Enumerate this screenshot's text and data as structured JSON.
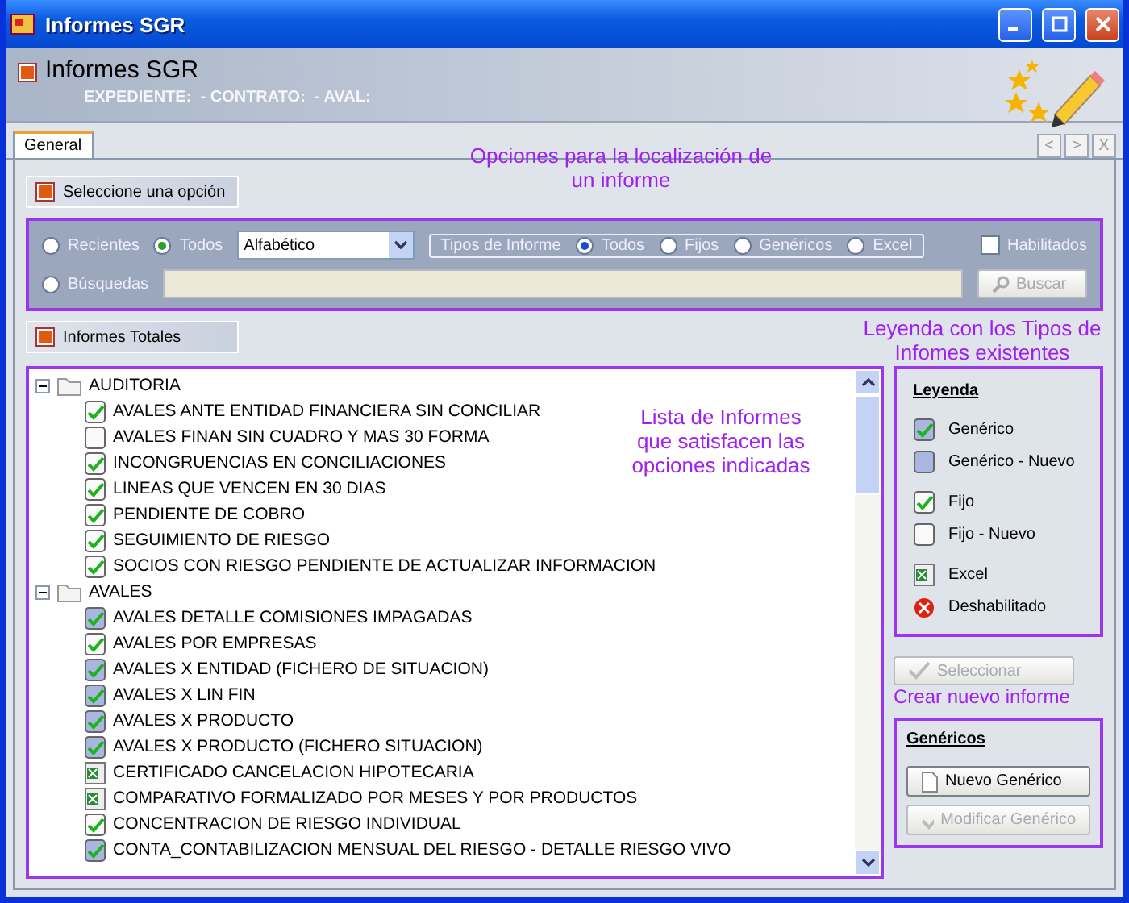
{
  "window": {
    "title": "Informes SGR"
  },
  "header": {
    "title": "Informes SGR",
    "subtitle": "EXPEDIENTE:  - CONTRATO:  - AVAL:"
  },
  "tabs": [
    {
      "label": "General",
      "selected": true
    }
  ],
  "tab_nav": [
    "<",
    ">",
    "X"
  ],
  "annotations": [
    {
      "lines": [
        "Opciones para la localización de",
        "un informe"
      ]
    },
    {
      "lines": [
        "Leyenda  con los Tipos de",
        "Infomes existentes"
      ]
    },
    {
      "lines": [
        "Lista de Informes",
        "que satisfacen las",
        "opciones indicadas"
      ]
    },
    {
      "lines": [
        "Crear nuevo informe"
      ]
    }
  ],
  "options_section": {
    "title": "Seleccione una opción"
  },
  "scope": [
    {
      "label": "Recientes",
      "selected": false
    },
    {
      "label": "Todos",
      "selected": true
    }
  ],
  "order_select": {
    "value": "Alfabético"
  },
  "report_types": {
    "legend": "Tipos de Informe",
    "options": [
      {
        "label": "Todos",
        "selected": true
      },
      {
        "label": "Fijos",
        "selected": false
      },
      {
        "label": "Genéricos",
        "selected": false
      },
      {
        "label": "Excel",
        "selected": false
      }
    ]
  },
  "enabled_filter": {
    "label": "Habilitados",
    "checked": false
  },
  "search": {
    "label": "Búsquedas",
    "selected": false,
    "button": "Buscar",
    "button_disabled": true
  },
  "list_section": {
    "title": "Informes Totales"
  },
  "tree": [
    {
      "label": "AUDITORIA",
      "expanded": true,
      "children": [
        {
          "label": "AVALES ANTE ENTIDAD FINANCIERA SIN CONCILIAR",
          "kind": "fijo"
        },
        {
          "label": "AVALES FINAN SIN CUADRO Y MAS 30 FORMA",
          "kind": "fijo_nuevo"
        },
        {
          "label": "INCONGRUENCIAS EN CONCILIACIONES",
          "kind": "fijo"
        },
        {
          "label": "LINEAS QUE VENCEN EN 30 DIAS",
          "kind": "fijo"
        },
        {
          "label": "PENDIENTE DE COBRO",
          "kind": "fijo"
        },
        {
          "label": "SEGUIMIENTO DE RIESGO",
          "kind": "fijo"
        },
        {
          "label": "SOCIOS CON RIESGO PENDIENTE DE ACTUALIZAR INFORMACION",
          "kind": "fijo"
        }
      ]
    },
    {
      "label": "AVALES",
      "expanded": true,
      "children": [
        {
          "label": "AVALES DETALLE COMISIONES IMPAGADAS",
          "kind": "generico"
        },
        {
          "label": "AVALES POR EMPRESAS",
          "kind": "fijo"
        },
        {
          "label": "AVALES X ENTIDAD (FICHERO DE SITUACION)",
          "kind": "generico"
        },
        {
          "label": "AVALES X LIN FIN",
          "kind": "generico"
        },
        {
          "label": "AVALES X PRODUCTO",
          "kind": "generico"
        },
        {
          "label": "AVALES X PRODUCTO (FICHERO SITUACION)",
          "kind": "generico"
        },
        {
          "label": "CERTIFICADO CANCELACION HIPOTECARIA",
          "kind": "excel"
        },
        {
          "label": "COMPARATIVO FORMALIZADO POR MESES Y POR PRODUCTOS",
          "kind": "excel"
        },
        {
          "label": "CONCENTRACION DE RIESGO INDIVIDUAL",
          "kind": "fijo"
        },
        {
          "label": "CONTA_CONTABILIZACION MENSUAL DEL RIESGO - DETALLE RIESGO VIVO",
          "kind": "generico"
        }
      ]
    }
  ],
  "legend": {
    "title": "Leyenda",
    "items": [
      {
        "label": "Genérico",
        "kind": "generico"
      },
      {
        "label": "Genérico - Nuevo",
        "kind": "generico_nuevo"
      },
      {
        "label": "Fijo",
        "kind": "fijo"
      },
      {
        "label": "Fijo - Nuevo",
        "kind": "fijo_nuevo"
      },
      {
        "label": "Excel",
        "kind": "excel"
      },
      {
        "label": "Deshabilitado",
        "kind": "deshabilitado"
      }
    ]
  },
  "select_button": {
    "label": "Seleccionar",
    "disabled": true
  },
  "generics": {
    "title": "Genéricos",
    "buttons": [
      {
        "label": "Nuevo Genérico",
        "disabled": false
      },
      {
        "label": "Modificar Genérico",
        "disabled": true
      }
    ]
  }
}
